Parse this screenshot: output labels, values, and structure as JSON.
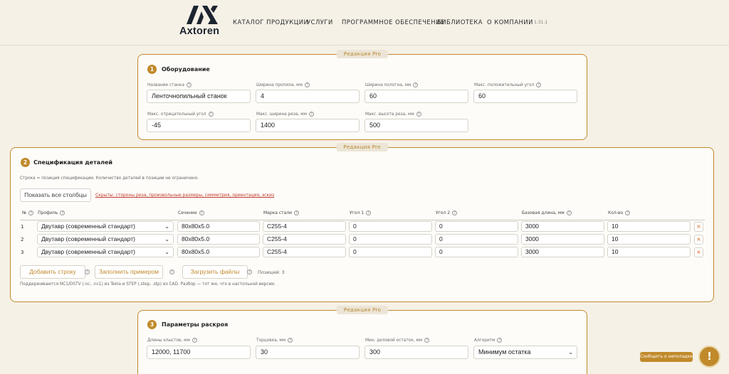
{
  "header": {
    "logo_text": "Axtoren",
    "nav": [
      "КАТАЛОГ ПРОДУКЦИИ",
      "УСЛУГИ",
      "ПРОГРАММНОЕ ОБЕСПЕЧЕНИЕ",
      "БИБЛИОТЕКА",
      "О КОМПАНИИ"
    ],
    "version": "1.31.1"
  },
  "badge": "Редакция Pro",
  "equipment": {
    "step": "1",
    "title": "Оборудование",
    "fields": [
      {
        "label": "Название станка",
        "value": "Ленточнопильный станок"
      },
      {
        "label": "Ширина пропила, мм",
        "value": "4"
      },
      {
        "label": "Ширина полотна, мм",
        "value": "60"
      },
      {
        "label": "Макс. положительный угол",
        "value": "60"
      },
      {
        "label": "Макс. отрицательный угол",
        "value": "-45"
      },
      {
        "label": "Макс. ширина реза, мм",
        "value": "1400"
      },
      {
        "label": "Макс. высота реза, мм",
        "value": "500"
      }
    ]
  },
  "spec": {
    "step": "2",
    "title": "Спецификация деталей",
    "hint": "Строка = позиция спецификации. Количество деталей в позиции не ограничено.",
    "show_columns_label": "Показать все столбцы",
    "hidden_link": "Скрыты: стороны реза, произвольные размеры, симметрия, ориентация, эскиз",
    "columns": [
      "№",
      "Профиль",
      "Сечение",
      "Марка стали",
      "Угол 1",
      "Угол 2",
      "Базовая длина, мм",
      "Кол-во"
    ],
    "rows": [
      {
        "num": "1",
        "profile": "Двутавр (современный стандарт)",
        "section": "80x80x5.0",
        "steel": "C255-4",
        "angle1": "0",
        "angle2": "0",
        "length": "3000",
        "qty": "10"
      },
      {
        "num": "2",
        "profile": "Двутавр (современный стандарт)",
        "section": "80x80x5.0",
        "steel": "C255-4",
        "angle1": "0",
        "angle2": "0",
        "length": "3000",
        "qty": "10"
      },
      {
        "num": "3",
        "profile": "Двутавр (современный стандарт)",
        "section": "80x80x5.0",
        "steel": "C255-4",
        "angle1": "0",
        "angle2": "0",
        "length": "3000",
        "qty": "10"
      }
    ],
    "delete_glyph": "×",
    "add_row_label": "Добавить строку",
    "fill_example_label": "Заполнить примером",
    "load_files_label": "Загрузить файлы",
    "positions_label": "Позиций: 3",
    "footer_hint": "Поддерживаются NC1/DSTV (.nc, .nc1) из Tekla и STEP (.step, .stp) из CAD. Разбор — тот же, что в настольной версии."
  },
  "cutting": {
    "step": "3",
    "title": "Параметры раскроя",
    "fields": [
      {
        "label": "Длины хлыстов, мм",
        "value": "12000, 11700"
      },
      {
        "label": "Торцовка, мм",
        "value": "30"
      },
      {
        "label": "Мин. деловой остаток, мм",
        "value": "300"
      },
      {
        "label": "Алгоритм",
        "value": "Минимум остатка"
      }
    ]
  },
  "floating": {
    "report_label": "Сообщить о неполадке",
    "alert_glyph": "!"
  },
  "colors": {
    "accent": "#c08a2b",
    "background": "#f6f1e7",
    "danger": "#c0392b"
  }
}
